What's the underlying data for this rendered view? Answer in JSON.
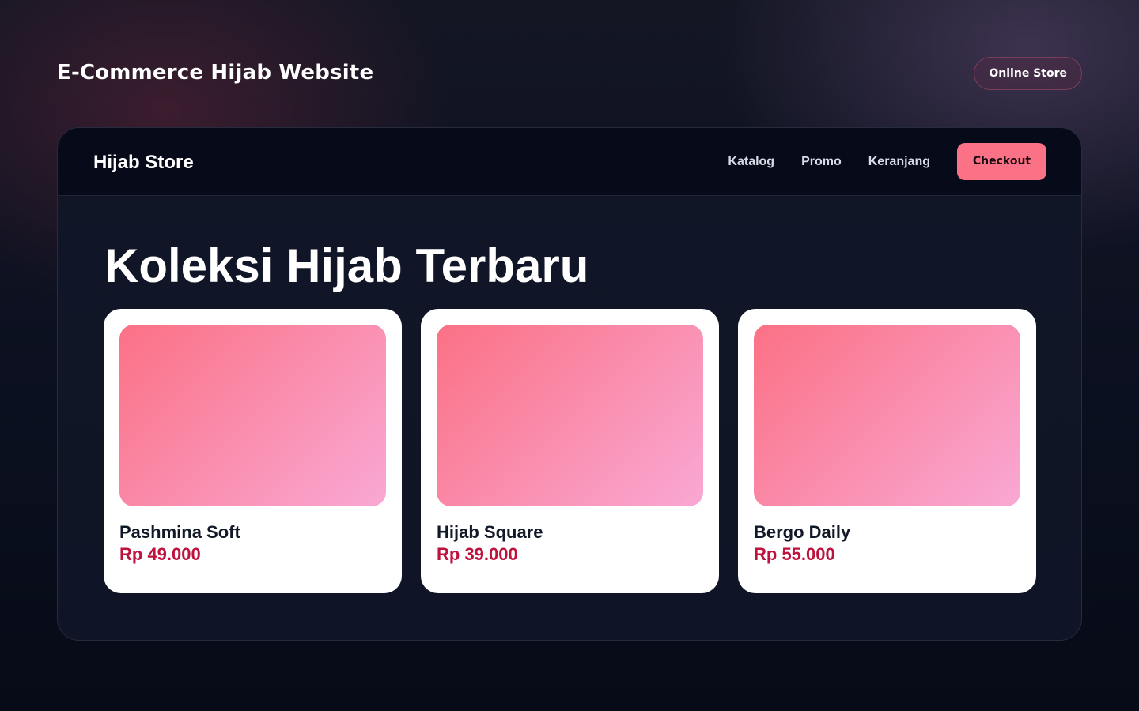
{
  "page": {
    "title": "E-Commerce Hijab Website",
    "badge": "Online Store"
  },
  "navbar": {
    "brand": "Hijab Store",
    "links": [
      "Katalog",
      "Promo",
      "Keranjang"
    ],
    "cta": "Checkout"
  },
  "main": {
    "heading": "Koleksi Hijab Terbaru",
    "products": [
      {
        "name": "Pashmina Soft",
        "price": "Rp 49.000"
      },
      {
        "name": "Hijab Square",
        "price": "Rp 39.000"
      },
      {
        "name": "Bergo Daily",
        "price": "Rp 55.000"
      }
    ]
  },
  "colors": {
    "accent": "#fb7185",
    "price": "#be123c",
    "image_gradient_start": "#fb7185",
    "image_gradient_end": "#f9a8d4"
  }
}
